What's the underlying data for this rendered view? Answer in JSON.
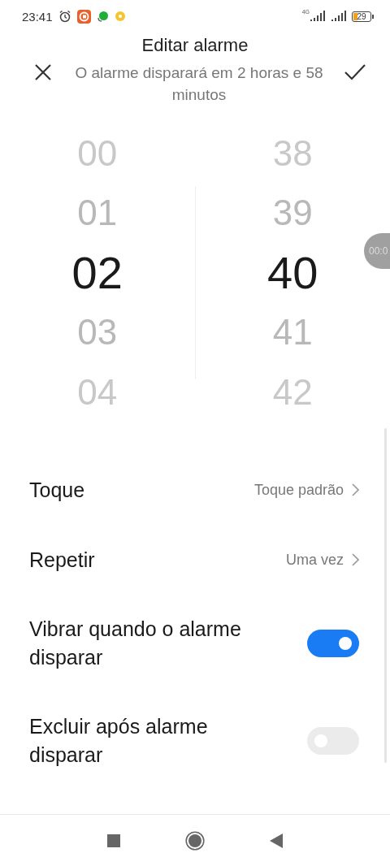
{
  "status_bar": {
    "time": "23:41",
    "network": "4G",
    "battery": "29"
  },
  "header": {
    "title": "Editar alarme",
    "subtitle": "O alarme disparará em 2 horas e 58 minutos"
  },
  "picker": {
    "hours": [
      {
        "value": "00",
        "selected": false
      },
      {
        "value": "01",
        "selected": false
      },
      {
        "value": "02",
        "selected": true
      },
      {
        "value": "03",
        "selected": false
      },
      {
        "value": "04",
        "selected": false
      }
    ],
    "minutes": [
      {
        "value": "38",
        "selected": false
      },
      {
        "value": "39",
        "selected": false
      },
      {
        "value": "40",
        "selected": true
      },
      {
        "value": "41",
        "selected": false
      },
      {
        "value": "42",
        "selected": false
      }
    ]
  },
  "floating_timer": {
    "text": "00:0"
  },
  "settings": [
    {
      "kind": "link",
      "label": "Toque",
      "value": "Toque padrão"
    },
    {
      "kind": "link",
      "label": "Repetir",
      "value": "Uma vez"
    },
    {
      "kind": "toggle",
      "label": "Vibrar quando o alarme disparar",
      "on": true
    },
    {
      "kind": "toggle",
      "label": "Excluir após alarme disparar",
      "on": false
    }
  ]
}
